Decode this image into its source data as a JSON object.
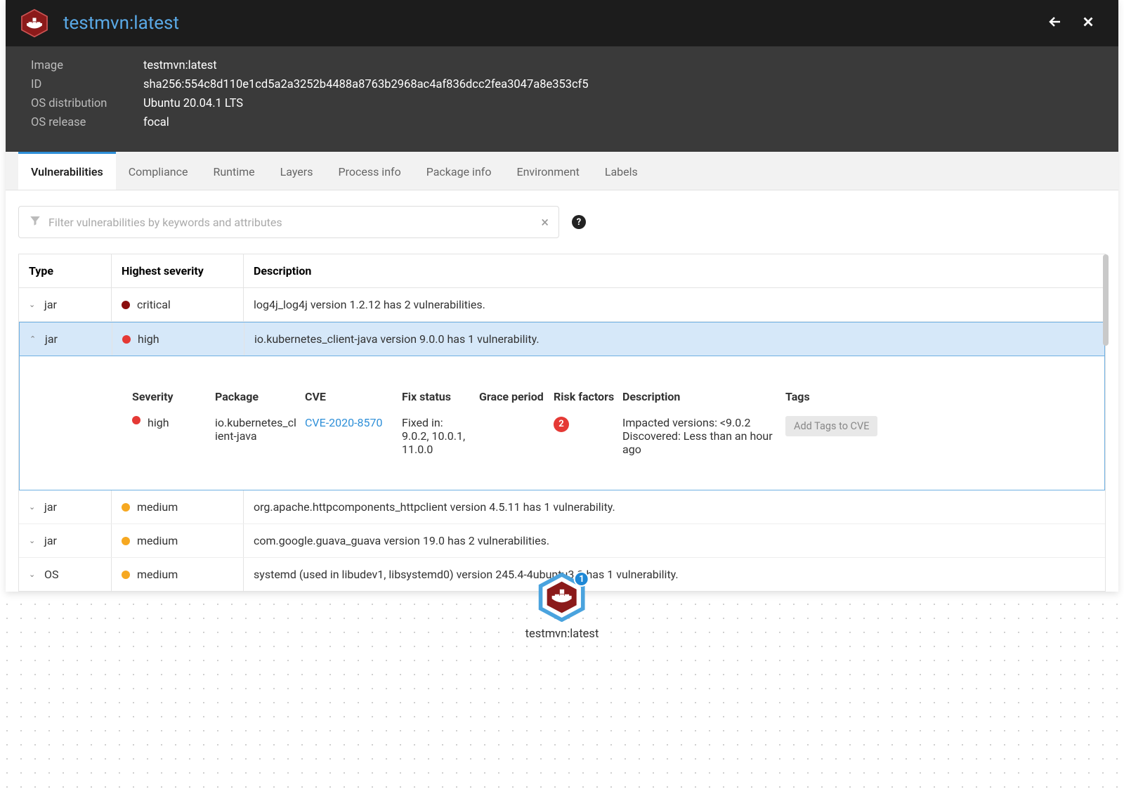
{
  "header": {
    "title": "testmvn:latest"
  },
  "meta": {
    "image_label": "Image",
    "image_value": "testmvn:latest",
    "id_label": "ID",
    "id_value": "sha256:554c8d110e1cd5a2a3252b4488a8763b2968ac4af836dcc2fea3047a8e353cf5",
    "os_dist_label": "OS distribution",
    "os_dist_value": "Ubuntu 20.04.1 LTS",
    "os_rel_label": "OS release",
    "os_rel_value": "focal"
  },
  "tabs": [
    "Vulnerabilities",
    "Compliance",
    "Runtime",
    "Layers",
    "Process info",
    "Package info",
    "Environment",
    "Labels"
  ],
  "filter": {
    "placeholder": "Filter vulnerabilities by keywords and attributes"
  },
  "table": {
    "headers": {
      "type": "Type",
      "severity": "Highest severity",
      "desc": "Description"
    },
    "rows": [
      {
        "type": "jar",
        "sev": "critical",
        "sev_class": "critical",
        "desc": "log4j_log4j version 1.2.12 has 2 vulnerabilities.",
        "expanded": false
      },
      {
        "type": "jar",
        "sev": "high",
        "sev_class": "high",
        "desc": "io.kubernetes_client-java version 9.0.0 has 1 vulnerability.",
        "expanded": true
      },
      {
        "type": "jar",
        "sev": "medium",
        "sev_class": "medium",
        "desc": "org.apache.httpcomponents_httpclient version 4.5.11 has 1 vulnerability.",
        "expanded": false
      },
      {
        "type": "jar",
        "sev": "medium",
        "sev_class": "medium",
        "desc": "com.google.guava_guava version 19.0 has 2 vulnerabilities.",
        "expanded": false
      },
      {
        "type": "OS",
        "sev": "medium",
        "sev_class": "medium",
        "desc": "systemd (used in libudev1, libsystemd0) version 245.4-4ubuntu3.3 has 1 vulnerability.",
        "expanded": false
      }
    ]
  },
  "detail": {
    "headers": {
      "sev": "Severity",
      "pkg": "Package",
      "cve": "CVE",
      "fix": "Fix status",
      "grace": "Grace period",
      "risk": "Risk factors",
      "desc": "Description",
      "tags": "Tags"
    },
    "row": {
      "sev": "high",
      "pkg": "io.kubernetes_client-java",
      "cve": "CVE-2020-8570",
      "fix": "Fixed in: 9.0.2, 10.0.1, 11.0.0",
      "risk": "2",
      "desc_l1": "Impacted versions: <9.0.2",
      "desc_l2": "Discovered: Less than an hour ago",
      "tag_btn": "Add Tags to CVE"
    }
  },
  "footer": {
    "badge": "1",
    "label": "testmvn:latest"
  }
}
